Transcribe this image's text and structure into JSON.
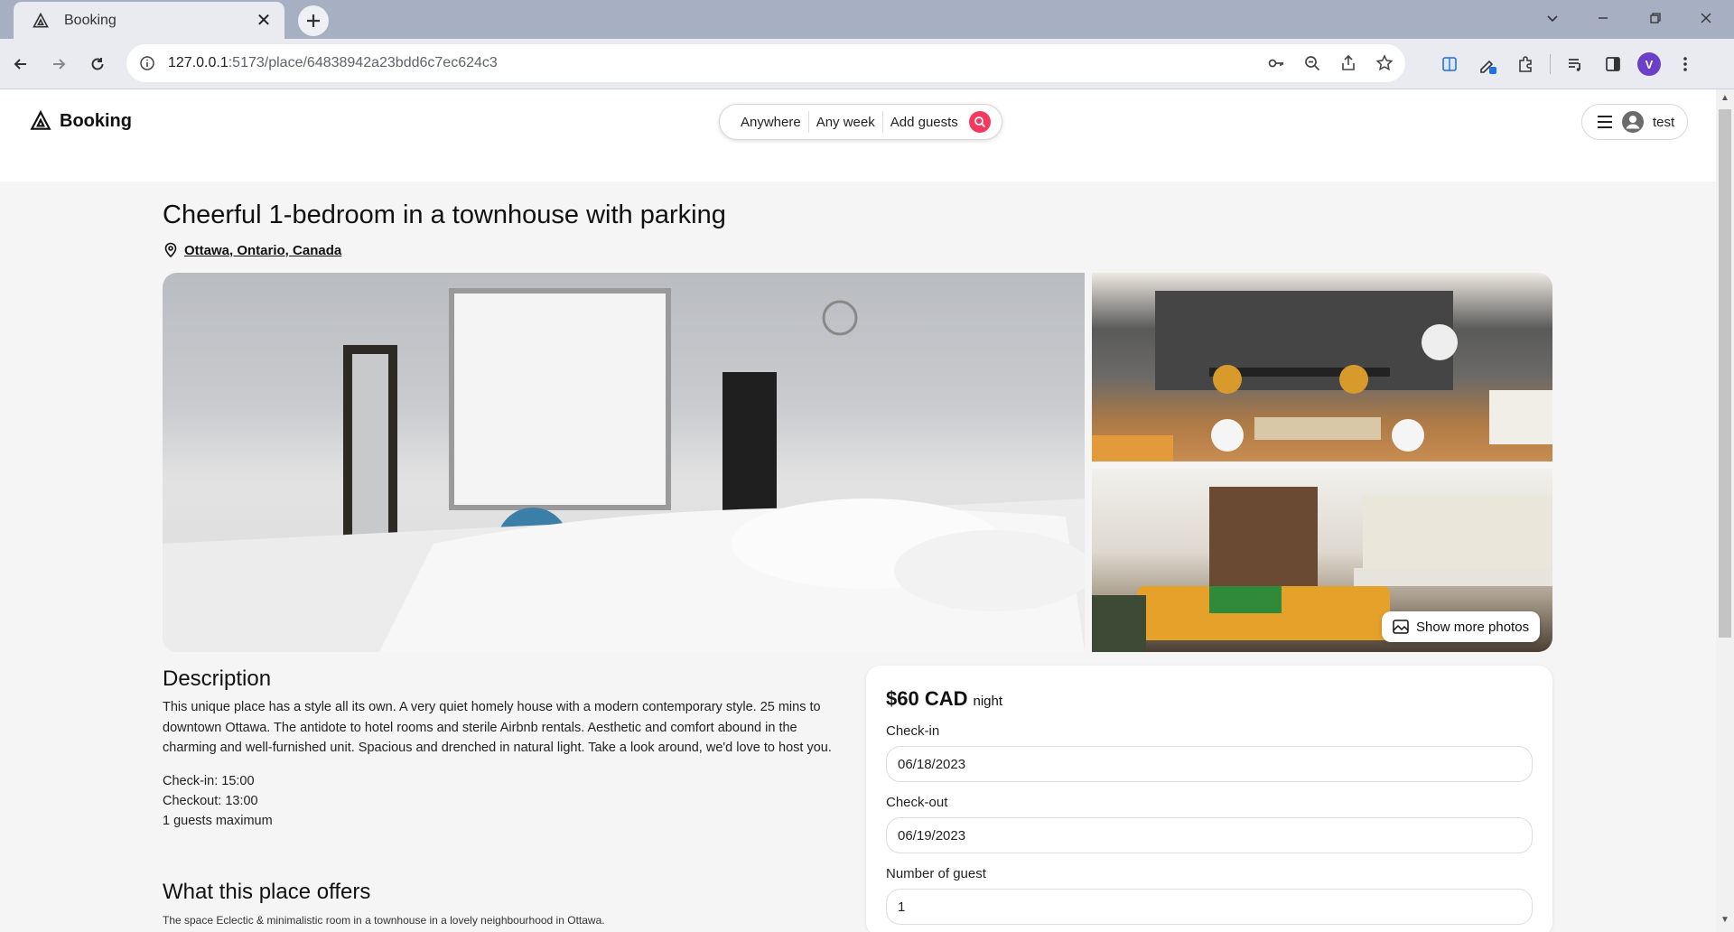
{
  "browser": {
    "tab_title": "Booking",
    "url_host": "127.0.0.1",
    "url_path": ":5173/place/64838942a23bdd6c7ec624c3",
    "profile_initial": "V"
  },
  "header": {
    "logo_text": "Booking",
    "search": {
      "where": "Anywhere",
      "when": "Any week",
      "guests": "Add guests"
    },
    "user_name": "test"
  },
  "place": {
    "title": "Cheerful 1-bedroom in a townhouse with parking",
    "location": "Ottawa, Ontario, Canada",
    "show_more_photos": "Show more photos",
    "description_heading": "Description",
    "description": "This unique place has a style all its own. A very quiet homely house with a modern contemporary style. 25 mins to downtown Ottawa. The antidote to hotel rooms and sterile Airbnb rentals. Aesthetic and comfort abound in the charming and well-furnished unit. Spacious and drenched in natural light. Take a look around, we'd love to host you.",
    "check_in": "Check-in: 15:00",
    "check_out": "Checkout: 13:00",
    "max_guests": "1 guests maximum",
    "offers_heading": "What this place offers",
    "offers_text": "The space Eclectic & minimalistic room in a townhouse in a lovely neighbourhood in Ottawa."
  },
  "booking": {
    "price": "$60 CAD",
    "per": "night",
    "checkin_label": "Check-in",
    "checkin_value": "06/18/2023",
    "checkout_label": "Check-out",
    "checkout_value": "06/19/2023",
    "guests_label": "Number of guest",
    "guests_value": "1"
  },
  "colors": {
    "accent": "#f5385d",
    "profile": "#6b3fc7"
  }
}
